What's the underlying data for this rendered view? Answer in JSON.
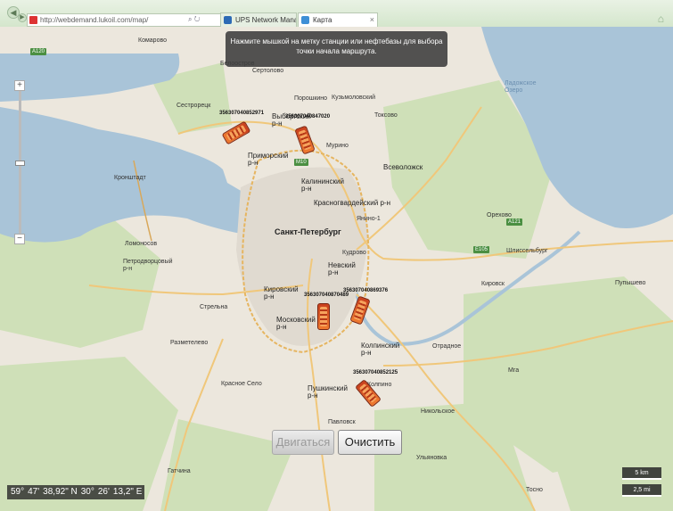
{
  "browser": {
    "address": "http://webdemand.lukoil.com/map/",
    "tabs": [
      {
        "label": "UPS Network Management Ca..."
      },
      {
        "label": "Карта"
      }
    ]
  },
  "map": {
    "tooltip": "Нажмите мышкой на метку станции или нефтебазы для выбора точки начала маршрута.",
    "places": [
      {
        "name": "Комарово"
      },
      {
        "name": "Белоостров"
      },
      {
        "name": "Сертолово"
      },
      {
        "name": "Порошкино"
      },
      {
        "name": "Сестрорецк"
      },
      {
        "name": "Кузьмоловский"
      },
      {
        "name": "Выборгский р-н"
      },
      {
        "name": "Приморский р-н"
      },
      {
        "name": "Калининский р-н"
      },
      {
        "name": "Красногвардейский р-н"
      },
      {
        "name": "Санкт-Петербург"
      },
      {
        "name": "Невский р-н"
      },
      {
        "name": "Кировский р-н"
      },
      {
        "name": "Московский р-н"
      },
      {
        "name": "Колпинский р-н"
      },
      {
        "name": "Пушкинский р-н"
      },
      {
        "name": "Всеволожск"
      },
      {
        "name": "Кронштадт"
      },
      {
        "name": "Ломоносов"
      },
      {
        "name": "Петродворцовый р-н"
      },
      {
        "name": "Кировск"
      },
      {
        "name": "Шлиссельбург"
      },
      {
        "name": "Ладожское Озеро"
      },
      {
        "name": "Мга"
      },
      {
        "name": "Павловск"
      },
      {
        "name": "Колпино"
      },
      {
        "name": "Отрадное"
      },
      {
        "name": "Никольское"
      },
      {
        "name": "Ульяновка"
      },
      {
        "name": "Тосно"
      },
      {
        "name": "Красное Село"
      },
      {
        "name": "Гатчина"
      },
      {
        "name": "Стрельна"
      },
      {
        "name": "Разметелево"
      },
      {
        "name": "Кудрово"
      },
      {
        "name": "Мурино"
      },
      {
        "name": "Янино-1"
      },
      {
        "name": "Токсово"
      },
      {
        "name": "Орехово"
      },
      {
        "name": "Пупышево"
      }
    ],
    "roads": [
      "A120",
      "A121",
      "E105",
      "M10"
    ],
    "markers": [
      {
        "label": "356307040852971"
      },
      {
        "label": "356307040847020"
      },
      {
        "label": "356307040870489"
      },
      {
        "label": "356307040869376"
      },
      {
        "label": "356307040852125"
      }
    ]
  },
  "controls": {
    "move_label": "Двигаться",
    "clear_label": "Очистить"
  },
  "coords": {
    "lat_deg": "59°",
    "lat_min": "47'",
    "lat_sec": "38,92\" N",
    "lon_deg": "30°",
    "lon_min": "26'",
    "lon_sec": "13,2\" E"
  },
  "scale": {
    "km": "5 km",
    "mi": "2,5 mi"
  },
  "colors": {
    "water": "#a9c4d8",
    "land": "#ece7dd",
    "forest": "#cfe0b8",
    "road_major": "#f0c77a",
    "marker": "#d4511f"
  }
}
